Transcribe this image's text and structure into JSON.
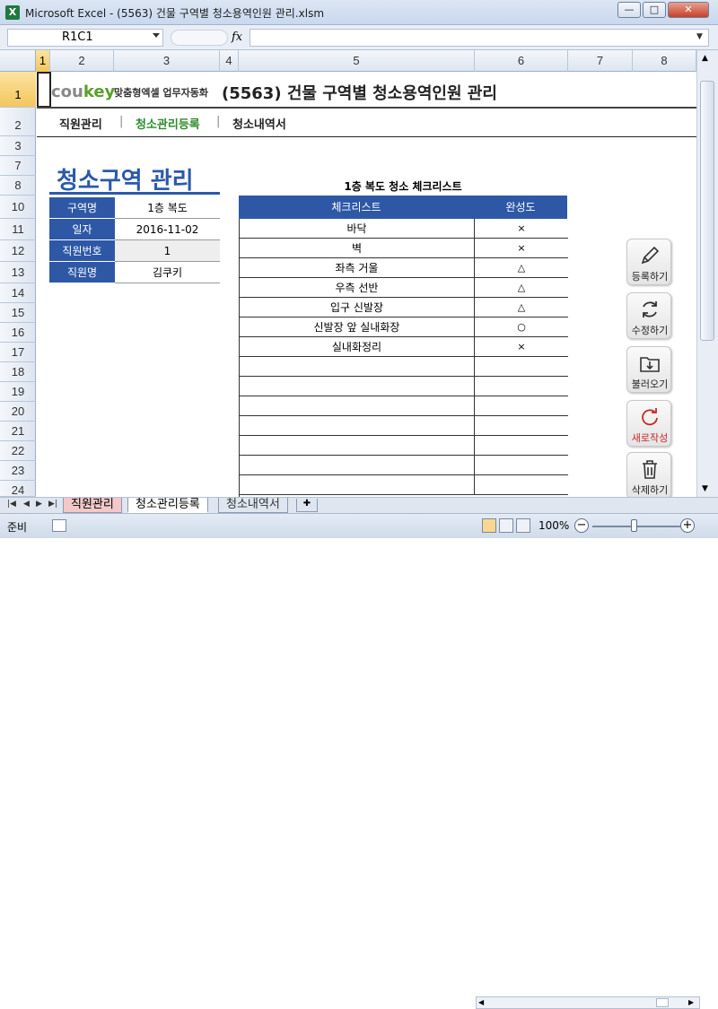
{
  "window": {
    "title": "Microsoft Excel - (5563) 건물 구역별 청소용역인원 관리.xlsm",
    "app_icon": "X",
    "minimize": "—",
    "maximize": "□",
    "close": "✕"
  },
  "formula_bar": {
    "name_box": "R1C1",
    "fx": "fx",
    "value": ""
  },
  "columns": [
    "1",
    "2",
    "3",
    "4",
    "5",
    "6",
    "7",
    "8"
  ],
  "rows": [
    "1",
    "2",
    "3",
    "7",
    "8",
    "10",
    "11",
    "12",
    "13",
    "14",
    "15",
    "16",
    "17",
    "18",
    "19",
    "20",
    "21",
    "22",
    "23",
    "24"
  ],
  "header": {
    "brand": "cou",
    "brand_key": "key",
    "brand_sub": "맞춤형엑셀 업무자동화",
    "title": "(5563) 건물 구역별 청소용역인원 관리"
  },
  "nav": {
    "items": [
      "직원관리",
      "청소관리등록",
      "청소내역서"
    ],
    "separator": "|"
  },
  "section_title": "청소구역 관리",
  "info": {
    "rows": [
      {
        "label": "구역명",
        "value": "1층 복도"
      },
      {
        "label": "일자",
        "value": "2016-11-02"
      },
      {
        "label": "직원번호",
        "value": "1"
      },
      {
        "label": "직원명",
        "value": "김쿠키"
      }
    ]
  },
  "checklist": {
    "title": "1층 복도 청소 체크리스트",
    "col_item": "체크리스트",
    "col_status": "완성도",
    "items": [
      {
        "name": "바닥",
        "mark": "×"
      },
      {
        "name": "벽",
        "mark": "×"
      },
      {
        "name": "좌측 거울",
        "mark": "△"
      },
      {
        "name": "우측 선반",
        "mark": "△"
      },
      {
        "name": "입구 신발장",
        "mark": "△"
      },
      {
        "name": "신발장 앞 실내화장",
        "mark": "○"
      },
      {
        "name": "실내화정리",
        "mark": "×"
      }
    ]
  },
  "actions": {
    "register": "등록하기",
    "edit": "수정하기",
    "load": "불러오기",
    "new": "새로작성",
    "delete": "삭제하기"
  },
  "tabs": [
    "직원관리",
    "청소관리등록",
    "청소내역서"
  ],
  "status": {
    "ready": "준비",
    "zoom": "100%"
  },
  "colors": {
    "accent_blue": "#2e58a6",
    "active_nav": "#2e8b2e",
    "new_red": "#c62828"
  }
}
